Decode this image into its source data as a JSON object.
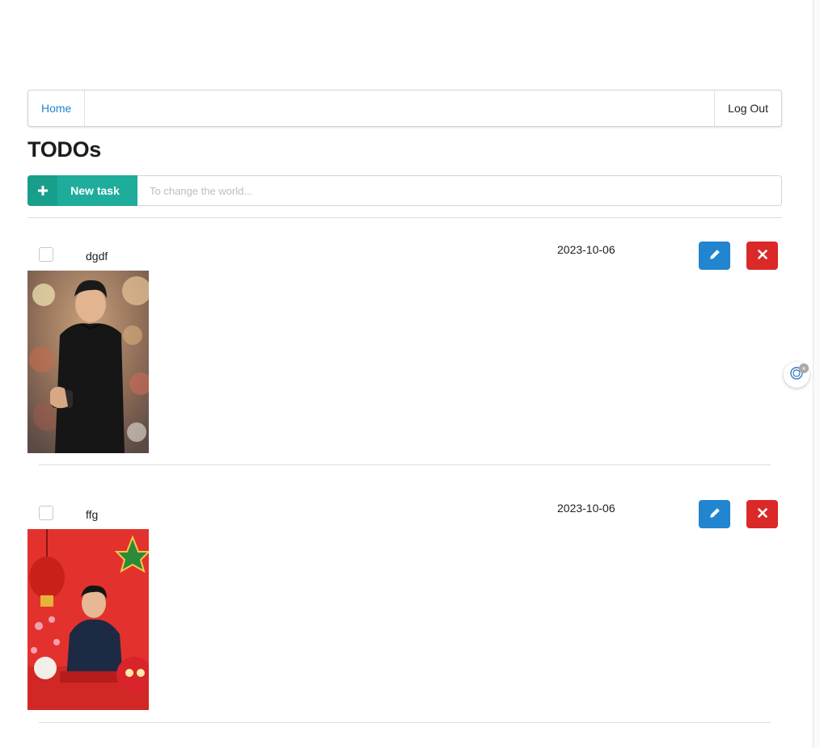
{
  "nav": {
    "home_label": "Home",
    "logout_label": "Log Out"
  },
  "page": {
    "title": "TODOs"
  },
  "new_task": {
    "button_label": "New task",
    "placeholder": "To change the world..."
  },
  "tasks": [
    {
      "title": "dgdf",
      "date": "2023-10-06",
      "checked": false,
      "photo_icon": "person-street-night-photo"
    },
    {
      "title": "ffg",
      "date": "2023-10-06",
      "checked": false,
      "photo_icon": "person-red-lantern-photo"
    }
  ],
  "colors": {
    "link": "#2185d0",
    "new_task_button": "#1fad9b",
    "edit_button": "#2185d0",
    "delete_button": "#db2828"
  }
}
